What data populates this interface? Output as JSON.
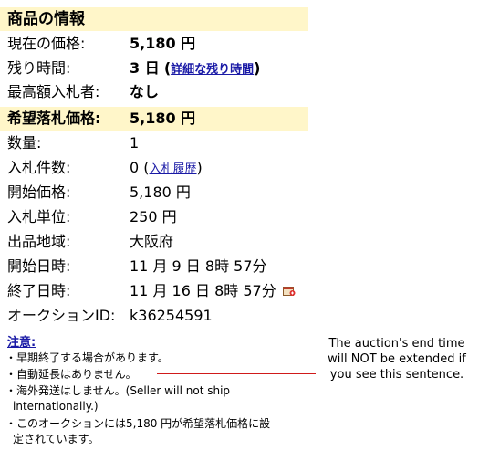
{
  "header": {
    "title": "商品の情報"
  },
  "rows": [
    {
      "label": "現在の価格:",
      "value": "5,180 円"
    },
    {
      "label": "残り時間:",
      "value": "3 日",
      "link": "詳細な残り時間"
    },
    {
      "label": "最高額入札者:",
      "value": "なし"
    },
    {
      "label": "希望落札価格:",
      "value": "5,180 円"
    },
    {
      "label": "数量:",
      "value": "1"
    },
    {
      "label": "入札件数:",
      "value": "0",
      "link": "入札履歴"
    },
    {
      "label": "開始価格:",
      "value": "5,180 円"
    },
    {
      "label": "入札単位:",
      "value": "250 円"
    },
    {
      "label": "出品地域:",
      "value": "大阪府"
    },
    {
      "label": "開始日時:",
      "value": "11 月 9 日 8時 57分"
    },
    {
      "label": "終了日時:",
      "value": "11 月 16 日 8時 57分"
    },
    {
      "label": "オークションID:",
      "value": "k36254591"
    }
  ],
  "notice": {
    "title": "注意:",
    "items": [
      "・早期終了する場合があります。",
      "・自動延長はありません。",
      "・海外発送はしません。(Seller will not ship",
      "internationally.)",
      "・このオークションには5,180 円が希望落札価格に設",
      "定されています。"
    ]
  },
  "callout": {
    "text": "The auction's end time will NOT be extended if you see this sentence.",
    "line_color": "#d01a1a"
  },
  "colors": {
    "header_bg": "#fff6c9",
    "link": "#1a1aa6"
  }
}
